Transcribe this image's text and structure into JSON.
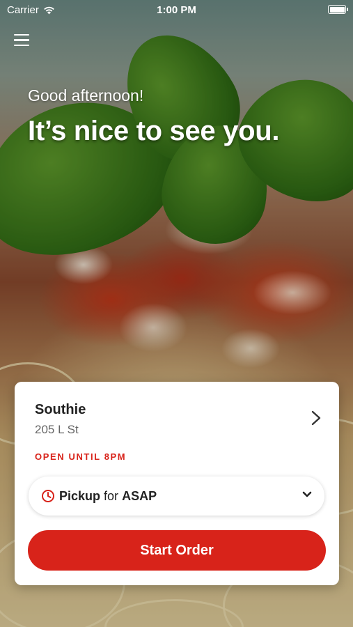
{
  "status_bar": {
    "carrier": "Carrier",
    "time": "1:00 PM"
  },
  "hero": {
    "greeting": "Good afternoon!",
    "headline": "It’s nice to see you."
  },
  "location": {
    "name": "Southie",
    "address": "205 L St",
    "hours": "OPEN UNTIL 8PM"
  },
  "order_mode": {
    "mode": "Pickup",
    "connector": "for",
    "time": "ASAP"
  },
  "actions": {
    "start_order": "Start Order"
  },
  "colors": {
    "accent": "#d8231a"
  },
  "icons": [
    "wifi-icon",
    "battery-icon",
    "hamburger-menu-icon",
    "chevron-right-icon",
    "clock-icon",
    "chevron-down-icon"
  ]
}
